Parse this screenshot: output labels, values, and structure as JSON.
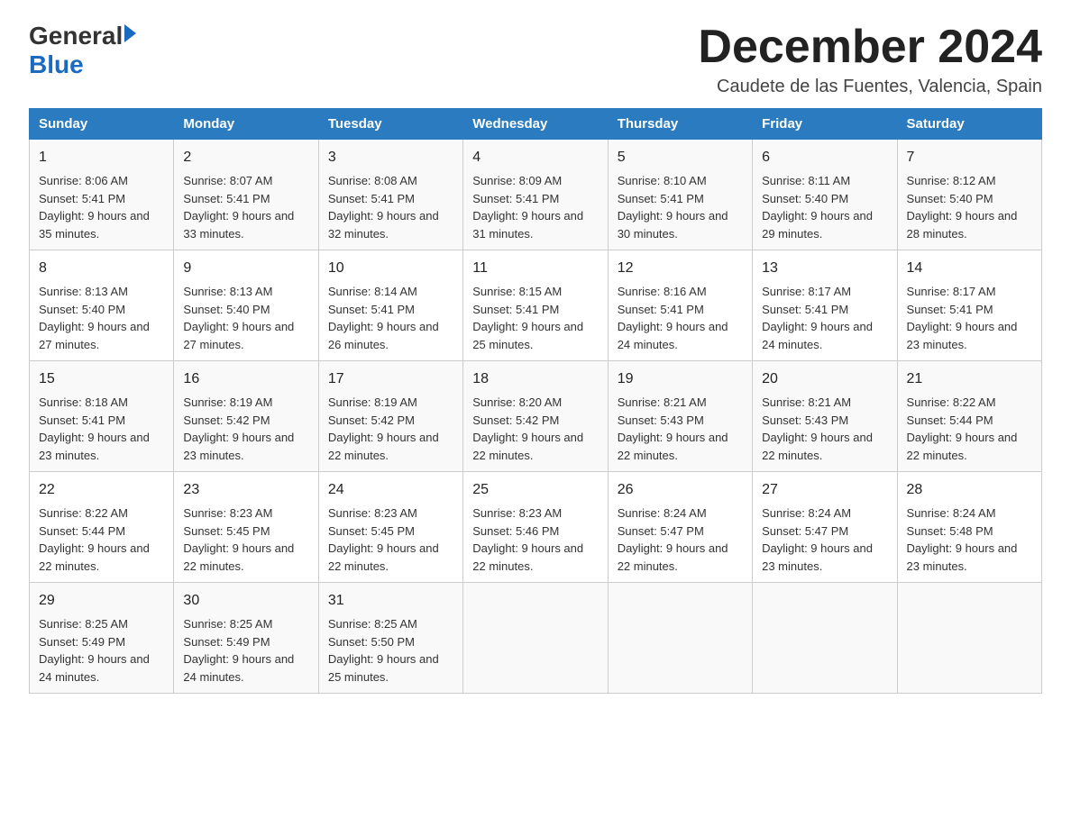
{
  "logo": {
    "general": "General",
    "blue": "Blue"
  },
  "title": "December 2024",
  "subtitle": "Caudete de las Fuentes, Valencia, Spain",
  "days": [
    "Sunday",
    "Monday",
    "Tuesday",
    "Wednesday",
    "Thursday",
    "Friday",
    "Saturday"
  ],
  "weeks": [
    [
      {
        "num": "1",
        "sunrise": "8:06 AM",
        "sunset": "5:41 PM",
        "daylight": "9 hours and 35 minutes."
      },
      {
        "num": "2",
        "sunrise": "8:07 AM",
        "sunset": "5:41 PM",
        "daylight": "9 hours and 33 minutes."
      },
      {
        "num": "3",
        "sunrise": "8:08 AM",
        "sunset": "5:41 PM",
        "daylight": "9 hours and 32 minutes."
      },
      {
        "num": "4",
        "sunrise": "8:09 AM",
        "sunset": "5:41 PM",
        "daylight": "9 hours and 31 minutes."
      },
      {
        "num": "5",
        "sunrise": "8:10 AM",
        "sunset": "5:41 PM",
        "daylight": "9 hours and 30 minutes."
      },
      {
        "num": "6",
        "sunrise": "8:11 AM",
        "sunset": "5:40 PM",
        "daylight": "9 hours and 29 minutes."
      },
      {
        "num": "7",
        "sunrise": "8:12 AM",
        "sunset": "5:40 PM",
        "daylight": "9 hours and 28 minutes."
      }
    ],
    [
      {
        "num": "8",
        "sunrise": "8:13 AM",
        "sunset": "5:40 PM",
        "daylight": "9 hours and 27 minutes."
      },
      {
        "num": "9",
        "sunrise": "8:13 AM",
        "sunset": "5:40 PM",
        "daylight": "9 hours and 27 minutes."
      },
      {
        "num": "10",
        "sunrise": "8:14 AM",
        "sunset": "5:41 PM",
        "daylight": "9 hours and 26 minutes."
      },
      {
        "num": "11",
        "sunrise": "8:15 AM",
        "sunset": "5:41 PM",
        "daylight": "9 hours and 25 minutes."
      },
      {
        "num": "12",
        "sunrise": "8:16 AM",
        "sunset": "5:41 PM",
        "daylight": "9 hours and 24 minutes."
      },
      {
        "num": "13",
        "sunrise": "8:17 AM",
        "sunset": "5:41 PM",
        "daylight": "9 hours and 24 minutes."
      },
      {
        "num": "14",
        "sunrise": "8:17 AM",
        "sunset": "5:41 PM",
        "daylight": "9 hours and 23 minutes."
      }
    ],
    [
      {
        "num": "15",
        "sunrise": "8:18 AM",
        "sunset": "5:41 PM",
        "daylight": "9 hours and 23 minutes."
      },
      {
        "num": "16",
        "sunrise": "8:19 AM",
        "sunset": "5:42 PM",
        "daylight": "9 hours and 23 minutes."
      },
      {
        "num": "17",
        "sunrise": "8:19 AM",
        "sunset": "5:42 PM",
        "daylight": "9 hours and 22 minutes."
      },
      {
        "num": "18",
        "sunrise": "8:20 AM",
        "sunset": "5:42 PM",
        "daylight": "9 hours and 22 minutes."
      },
      {
        "num": "19",
        "sunrise": "8:21 AM",
        "sunset": "5:43 PM",
        "daylight": "9 hours and 22 minutes."
      },
      {
        "num": "20",
        "sunrise": "8:21 AM",
        "sunset": "5:43 PM",
        "daylight": "9 hours and 22 minutes."
      },
      {
        "num": "21",
        "sunrise": "8:22 AM",
        "sunset": "5:44 PM",
        "daylight": "9 hours and 22 minutes."
      }
    ],
    [
      {
        "num": "22",
        "sunrise": "8:22 AM",
        "sunset": "5:44 PM",
        "daylight": "9 hours and 22 minutes."
      },
      {
        "num": "23",
        "sunrise": "8:23 AM",
        "sunset": "5:45 PM",
        "daylight": "9 hours and 22 minutes."
      },
      {
        "num": "24",
        "sunrise": "8:23 AM",
        "sunset": "5:45 PM",
        "daylight": "9 hours and 22 minutes."
      },
      {
        "num": "25",
        "sunrise": "8:23 AM",
        "sunset": "5:46 PM",
        "daylight": "9 hours and 22 minutes."
      },
      {
        "num": "26",
        "sunrise": "8:24 AM",
        "sunset": "5:47 PM",
        "daylight": "9 hours and 22 minutes."
      },
      {
        "num": "27",
        "sunrise": "8:24 AM",
        "sunset": "5:47 PM",
        "daylight": "9 hours and 23 minutes."
      },
      {
        "num": "28",
        "sunrise": "8:24 AM",
        "sunset": "5:48 PM",
        "daylight": "9 hours and 23 minutes."
      }
    ],
    [
      {
        "num": "29",
        "sunrise": "8:25 AM",
        "sunset": "5:49 PM",
        "daylight": "9 hours and 24 minutes."
      },
      {
        "num": "30",
        "sunrise": "8:25 AM",
        "sunset": "5:49 PM",
        "daylight": "9 hours and 24 minutes."
      },
      {
        "num": "31",
        "sunrise": "8:25 AM",
        "sunset": "5:50 PM",
        "daylight": "9 hours and 25 minutes."
      },
      null,
      null,
      null,
      null
    ]
  ]
}
